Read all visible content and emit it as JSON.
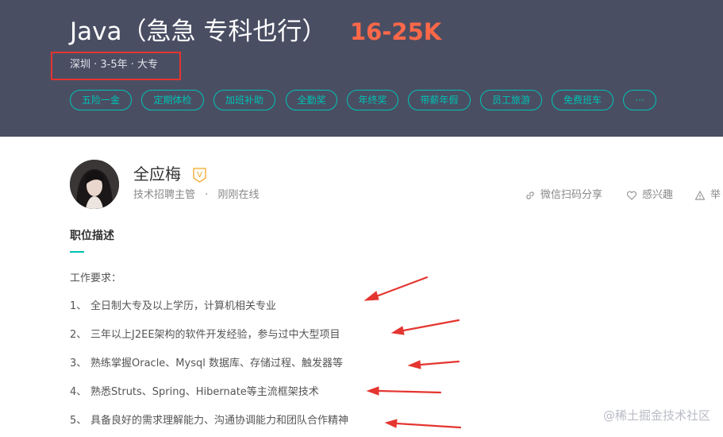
{
  "banner": {
    "cut_text": "—",
    "title": "Java（急急 专科也行）",
    "salary": "16-25K",
    "meta": "深圳 · 3-5年 · 大专",
    "tags": [
      "五险一金",
      "定期体检",
      "加班补助",
      "全勤奖",
      "年终奖",
      "带薪年假",
      "员工旅游",
      "免费班车",
      "···"
    ]
  },
  "recruiter": {
    "name": "全应梅",
    "badge": "V",
    "role": "技术招聘主管",
    "separator": "·",
    "status": "刚刚在线"
  },
  "actions": {
    "share": "微信扫码分享",
    "favorite": "感兴趣",
    "report": "举"
  },
  "description": {
    "heading": "职位描述",
    "intro": "工作要求：",
    "items": [
      {
        "num": "1、",
        "text": "全日制大专及以上学历，计算机相关专业"
      },
      {
        "num": "2、",
        "text": "三年以上J2EE架构的软件开发经验，参与过中大型项目"
      },
      {
        "num": "3、",
        "text": "熟练掌握Oracle、Mysql 数据库、存储过程、触发器等"
      },
      {
        "num": "4、",
        "text": "熟悉Struts、Spring、Hibernate等主流框架技术"
      },
      {
        "num": "5、",
        "text": "具备良好的需求理解能力、沟通协调能力和团队合作精神"
      }
    ]
  },
  "watermark": "@稀土掘金技术社区",
  "colors": {
    "banner_bg": "#4a4e63",
    "salary": "#fd6849",
    "accent": "#00c2b3",
    "annotation_red": "#e43530",
    "badge_orange": "#f5a623"
  }
}
